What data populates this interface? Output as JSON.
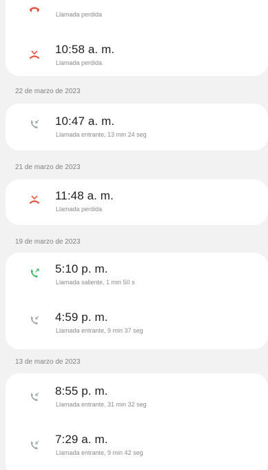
{
  "call_log": {
    "groups": [
      {
        "date": "",
        "entries": [
          {
            "time": "",
            "detail": "Llamada perdida",
            "icon": "missed-call-icon"
          },
          {
            "time": "10:58 a. m.",
            "detail": "Llamada perdida",
            "icon": "missed-call-icon"
          }
        ]
      },
      {
        "date": "22 de marzo de 2023",
        "entries": [
          {
            "time": "10:47 a. m.",
            "detail": "Llamada entrante, 13 min 24 seg",
            "icon": "incoming-call-icon"
          }
        ]
      },
      {
        "date": "21 de marzo de 2023",
        "entries": [
          {
            "time": "11:48 a. m.",
            "detail": "Llamada perdida",
            "icon": "missed-call-icon"
          }
        ]
      },
      {
        "date": "19 de marzo de 2023",
        "entries": [
          {
            "time": "5:10 p. m.",
            "detail": "Llamada saliente, 1 min 50 s",
            "icon": "outgoing-call-icon"
          },
          {
            "time": "4:59 p. m.",
            "detail": "Llamada entrante, 9 min 37 seg",
            "icon": "incoming-call-icon"
          }
        ]
      },
      {
        "date": "13 de marzo de 2023",
        "entries": [
          {
            "time": "8:55 p. m.",
            "detail": "Llamada entrante, 31 min 32 seg",
            "icon": "incoming-call-icon"
          },
          {
            "time": "7:29 a. m.",
            "detail": "Llamada entrante, 9 min 42 seg",
            "icon": "incoming-call-icon"
          }
        ]
      }
    ]
  },
  "colors": {
    "missed": "#e8533f",
    "incoming": "#9aa4ab",
    "outgoing": "#2fb55a"
  }
}
